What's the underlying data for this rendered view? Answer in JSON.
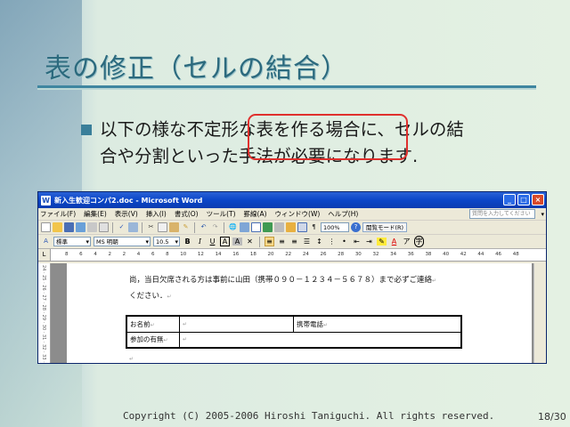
{
  "slide": {
    "title": "表の修正（セルの結合）",
    "bullet_line1": "以下の様な不定形な表を作る場合に、セルの結",
    "bullet_line2": "合や分割といった手法が必要になります.",
    "copyright": "Copyright (C) 2005-2006 Hiroshi Taniguchi. All rights reserved.",
    "page_number": "18/30"
  },
  "window": {
    "title": "新入生歓迎コンパ2.doc - Microsoft Word",
    "menus": [
      "ファイル(F)",
      "編集(E)",
      "表示(V)",
      "挿入(I)",
      "書式(O)",
      "ツール(T)",
      "罫線(A)",
      "ウィンドウ(W)",
      "ヘルプ(H)"
    ],
    "help_placeholder": "質問を入力してください",
    "zoom": "100%",
    "read_mode": "閲覧モード(R)",
    "style": "標準",
    "font": "MS 明朝",
    "font_size": "10.5",
    "ruler_numbers": [
      "8",
      "6",
      "4",
      "2",
      "2",
      "4",
      "6",
      "8",
      "10",
      "12",
      "14",
      "16",
      "18",
      "20",
      "22",
      "24",
      "26",
      "28",
      "30",
      "32",
      "34",
      "36",
      "38",
      "40",
      "42",
      "44",
      "46",
      "48"
    ],
    "vruler_text": "24 · 25 · 26 · 27 · 28 · 29 · 30 · 31 · 32 · 33 · 34 · 35 · 36"
  },
  "document": {
    "line1": "尚，当日欠席される方は事前に山田（携帯０９０－１２３４－５６７８）まで必ずご連絡",
    "line2": "ください．",
    "cell_name": "お名前",
    "cell_phone": "携帯電話",
    "cell_attend": "参加の有無"
  },
  "colors": {
    "title": "#2c6a7e",
    "highlight": "#e0302d",
    "word_titlebar": "#0b46c8"
  }
}
